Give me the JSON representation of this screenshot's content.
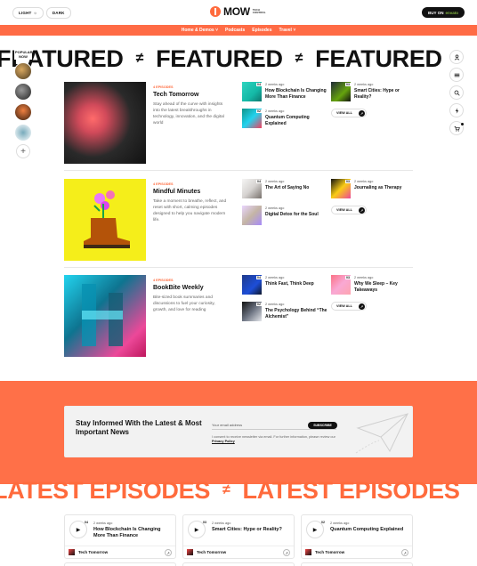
{
  "header": {
    "light_label": "LIGHT",
    "dark_label": "DARK",
    "logo_text": "MOW",
    "logo_sub": "TECH CONTROL",
    "buy_label": "BUY ON",
    "buy_brand": "envato"
  },
  "nav": [
    {
      "label": "Home & Demos ˅"
    },
    {
      "label": "Podcasts"
    },
    {
      "label": "Episodes"
    },
    {
      "label": "Travel ˅"
    }
  ],
  "featured_marquee": {
    "word": "FEATURED",
    "separator": "≠"
  },
  "left_stack": {
    "popular_label": "POPULAR NOW"
  },
  "featured_rows": [
    {
      "episodes": "4 EPISODES",
      "title": "Tech Tomorrow",
      "desc": "Stay ahead of the curve with insights into the latest breakthroughs in technology, innovation, and the digital world",
      "items": [
        {
          "num": "04",
          "date": "2 weeks ago",
          "title": "How Blockchain Is Changing More Than Finance"
        },
        {
          "num": "02",
          "date": "2 weeks ago",
          "title": "Quantum Computing Explained"
        },
        {
          "num": "03",
          "date": "2 weeks ago",
          "title": "Smart Cities: Hype or Reality?"
        }
      ],
      "view_all": "VIEW ALL"
    },
    {
      "episodes": "4 EPISODES",
      "title": "Mindful Minutes",
      "desc": "Take a moment to breathe, reflect, and reset with short, calming episodes designed to help you navigate modern life.",
      "items": [
        {
          "num": "04",
          "date": "2 weeks ago",
          "title": "The Art of Saying No"
        },
        {
          "num": "",
          "date": "2 weeks ago",
          "title": "Digital Detox for the Soul"
        },
        {
          "num": "03",
          "date": "2 weeks ago",
          "title": "Journaling as Therapy"
        }
      ],
      "view_all": "VIEW ALL"
    },
    {
      "episodes": "4 EPISODES",
      "title": "BookBite Weekly",
      "desc": "Bite-sized book summaries and discussions to fuel your curiosity, growth, and love for reading",
      "items": [
        {
          "num": "04",
          "date": "2 weeks ago",
          "title": "Think Fast, Think Deep"
        },
        {
          "num": "02",
          "date": "2 weeks ago",
          "title": "The Psychology Behind “The Alchemist”"
        },
        {
          "num": "03",
          "date": "2 weeks ago",
          "title": "Why We Sleep – Key Takeaways"
        }
      ],
      "view_all": "VIEW ALL"
    }
  ],
  "newsletter": {
    "title": "Stay Informed With the Latest & Most Important News",
    "placeholder": "Your email address",
    "button": "SUBSCRIBE",
    "consent": "I consent to receive newsletter via email. For further information, please review our",
    "policy": "Privacy Policy"
  },
  "latest_marquee": {
    "word": "LATEST EPISODES",
    "separator": "≠"
  },
  "latest_cards": [
    {
      "num": "04",
      "date": "2 weeks ago",
      "title": "How Blockchain Is Changing More Than Finance",
      "show": "Tech Tomorrow"
    },
    {
      "num": "03",
      "date": "2 weeks ago",
      "title": "Smart Cities: Hype or Reality?",
      "show": "Tech Tomorrow"
    },
    {
      "num": "02",
      "date": "2 weeks ago",
      "title": "Quantum Computing Explained",
      "show": "Tech Tomorrow"
    }
  ],
  "colors": {
    "accent": "#ff6b3d",
    "dark": "#111111"
  }
}
